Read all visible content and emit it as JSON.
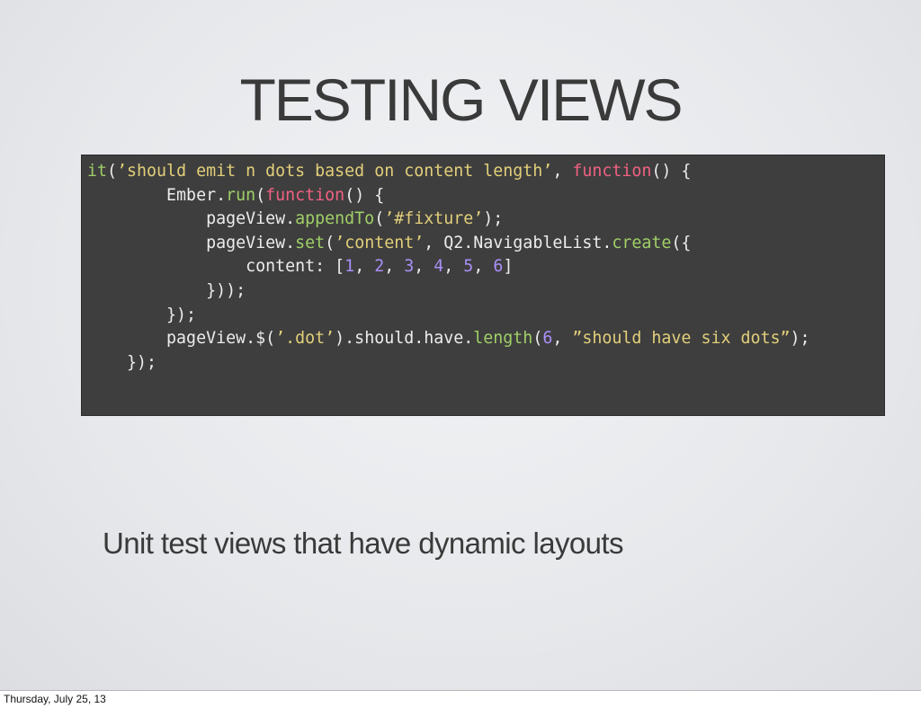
{
  "slide": {
    "title": "TESTING VIEWS",
    "subtitle": "Unit test views that have dynamic layouts"
  },
  "code": {
    "lines": [
      [
        {
          "t": "fn",
          "s": "it"
        },
        {
          "t": "plain",
          "s": "("
        },
        {
          "t": "str",
          "s": "’should emit n dots based on content length’"
        },
        {
          "t": "plain",
          "s": ", "
        },
        {
          "t": "kw",
          "s": "function"
        },
        {
          "t": "plain",
          "s": "() {"
        }
      ],
      [
        {
          "t": "plain",
          "s": "        Ember."
        },
        {
          "t": "fn",
          "s": "run"
        },
        {
          "t": "plain",
          "s": "("
        },
        {
          "t": "kw",
          "s": "function"
        },
        {
          "t": "plain",
          "s": "() {"
        }
      ],
      [
        {
          "t": "plain",
          "s": "            pageView."
        },
        {
          "t": "fn",
          "s": "appendTo"
        },
        {
          "t": "plain",
          "s": "("
        },
        {
          "t": "str",
          "s": "’#fixture’"
        },
        {
          "t": "plain",
          "s": ");"
        }
      ],
      [
        {
          "t": "plain",
          "s": "            pageView."
        },
        {
          "t": "fn",
          "s": "set"
        },
        {
          "t": "plain",
          "s": "("
        },
        {
          "t": "str",
          "s": "’content’"
        },
        {
          "t": "plain",
          "s": ", Q2.NavigableList."
        },
        {
          "t": "fn",
          "s": "create"
        },
        {
          "t": "plain",
          "s": "({"
        }
      ],
      [
        {
          "t": "plain",
          "s": "                content: ["
        },
        {
          "t": "num",
          "s": "1"
        },
        {
          "t": "plain",
          "s": ", "
        },
        {
          "t": "num",
          "s": "2"
        },
        {
          "t": "plain",
          "s": ", "
        },
        {
          "t": "num",
          "s": "3"
        },
        {
          "t": "plain",
          "s": ", "
        },
        {
          "t": "num",
          "s": "4"
        },
        {
          "t": "plain",
          "s": ", "
        },
        {
          "t": "num",
          "s": "5"
        },
        {
          "t": "plain",
          "s": ", "
        },
        {
          "t": "num",
          "s": "6"
        },
        {
          "t": "plain",
          "s": "]"
        }
      ],
      [
        {
          "t": "plain",
          "s": "            }));"
        }
      ],
      [
        {
          "t": "plain",
          "s": "        });"
        }
      ],
      [
        {
          "t": "plain",
          "s": "        pageView.$("
        },
        {
          "t": "str",
          "s": "’.dot’"
        },
        {
          "t": "plain",
          "s": ").should.have."
        },
        {
          "t": "fn",
          "s": "length"
        },
        {
          "t": "plain",
          "s": "("
        },
        {
          "t": "num",
          "s": "6"
        },
        {
          "t": "plain",
          "s": ", "
        },
        {
          "t": "str",
          "s": "”should have six dots”"
        },
        {
          "t": "plain",
          "s": ");"
        }
      ],
      [
        {
          "t": "plain",
          "s": "    });"
        }
      ]
    ]
  },
  "footer": {
    "date": "Thursday, July 25, 13"
  },
  "colors": {
    "slide_background": "#e6e8eb",
    "code_background": "#3e3e3e",
    "code_text": "#ececec",
    "code_function": "#9fd067",
    "code_string": "#e2cf7a",
    "code_keyword": "#f06182",
    "code_number": "#a98ff6",
    "title_text": "#3a3a3a"
  }
}
